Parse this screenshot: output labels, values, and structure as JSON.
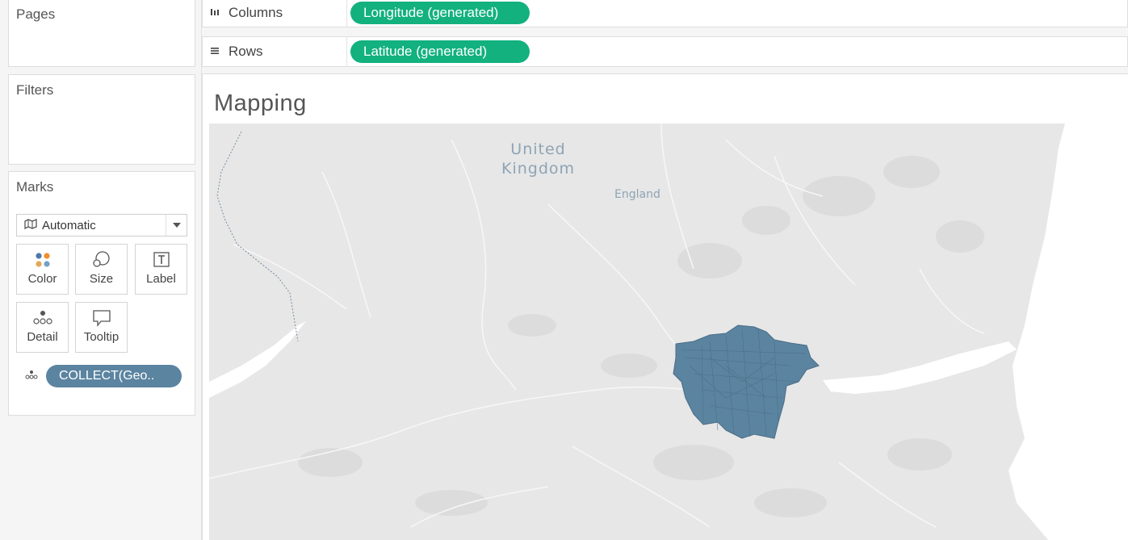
{
  "shelves": {
    "pages_label": "Pages",
    "filters_label": "Filters",
    "marks_label": "Marks",
    "columns_label": "Columns",
    "rows_label": "Rows",
    "columns_pill": "Longitude (generated)",
    "rows_pill": "Latitude (generated)"
  },
  "marks": {
    "mark_type": "Automatic",
    "buttons": {
      "color": "Color",
      "size": "Size",
      "label": "Label",
      "detail": "Detail",
      "tooltip": "Tooltip"
    },
    "field_pill": "COLLECT(Geo.."
  },
  "viz": {
    "title": "Mapping",
    "map_labels": {
      "country_line1": "United",
      "country_line2": "Kingdom",
      "region": "England"
    }
  },
  "colors": {
    "pill_green": "#12b17e",
    "pill_blue": "#5b84a1",
    "map_fill": "#5b84a1",
    "land": "#e7e7e7",
    "sea": "#ffffff"
  }
}
